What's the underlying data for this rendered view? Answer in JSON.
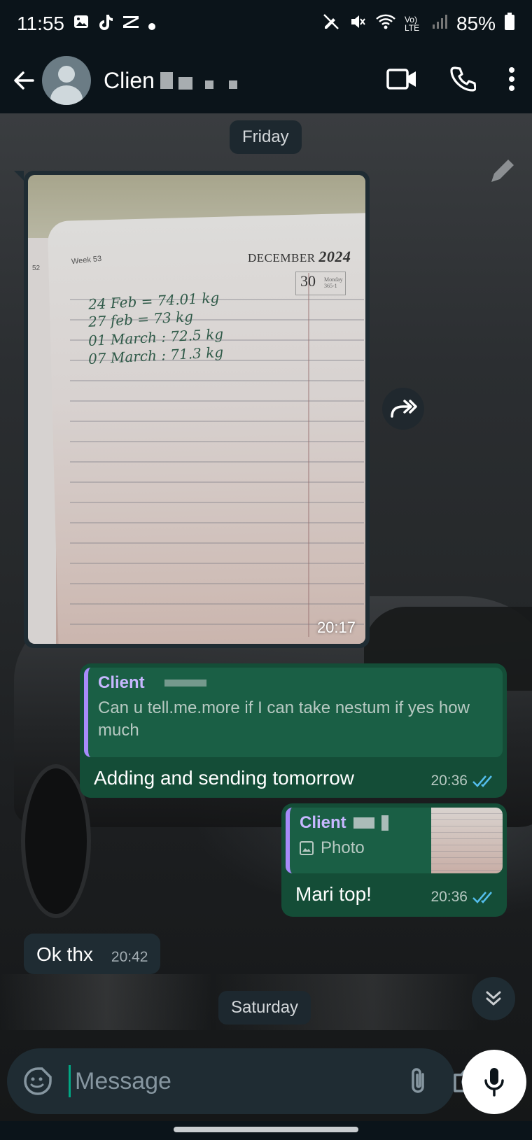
{
  "status_bar": {
    "time": "11:55",
    "battery": "85%",
    "network": "Vo) LTE"
  },
  "header": {
    "contact_name": "Clien"
  },
  "chat": {
    "date_friday": "Friday",
    "date_saturday": "Saturday",
    "image_message": {
      "time": "20:17",
      "photo_text": {
        "week": "Week 53",
        "page_num": "52",
        "month": "DECEMBER",
        "year": "2024",
        "day": "30",
        "day_small": "Monday 365-1",
        "lines": [
          "24 Feb = 74.01 kg",
          "27 feb = 73 kg",
          "01 March : 72.5 kg",
          "07 March : 71.3 kg"
        ]
      }
    },
    "reply_1": {
      "quote_author": "Client",
      "quote_text": "Can u tell.me.more if I can take nestum if yes how much",
      "text": "Adding and sending  tomorrow",
      "time": "20:36"
    },
    "reply_2": {
      "quote_author": "Client",
      "quote_type": "Photo",
      "text": "Mari top!",
      "time": "20:36"
    },
    "incoming_1": {
      "text": "Ok thx",
      "time": "20:42"
    }
  },
  "composer": {
    "placeholder": "Message"
  },
  "colors": {
    "outgoing_bubble": "#144d37",
    "incoming_bubble": "#1f2c33",
    "quote_accent": "#a78bfa",
    "read_ticks": "#53bdeb"
  }
}
